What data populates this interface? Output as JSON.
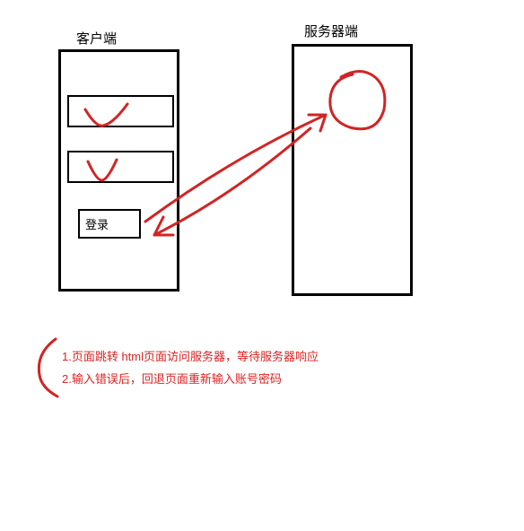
{
  "labels": {
    "client": "客户端",
    "server": "服务器端",
    "login": "登录"
  },
  "notes": {
    "line1": "1.页面跳转  html页面访问服务器，等待服务器响应",
    "line2": "2.输入错误后，回退页面重新输入账号密码"
  },
  "colors": {
    "annotation": "#d22424"
  }
}
